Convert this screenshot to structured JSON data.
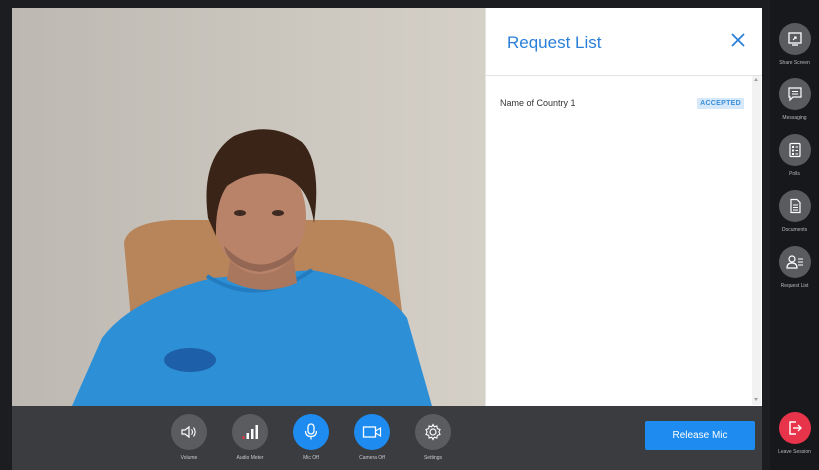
{
  "panel": {
    "title": "Request List",
    "requests": [
      {
        "name": "Name of Country 1",
        "status": "ACCEPTED"
      }
    ]
  },
  "rail": {
    "items": [
      {
        "label": "Share Screen",
        "icon": "share-screen-icon"
      },
      {
        "label": "Messaging",
        "icon": "message-icon"
      },
      {
        "label": "Polls",
        "icon": "polls-icon"
      },
      {
        "label": "Documents",
        "icon": "document-icon"
      },
      {
        "label": "Request List",
        "icon": "request-list-icon"
      }
    ],
    "leave_label": "Leave Session"
  },
  "controls": {
    "items": [
      {
        "label": "Volume",
        "icon": "speaker-icon",
        "active": false
      },
      {
        "label": "Audio Meter",
        "icon": "audio-meter-icon",
        "active": false
      },
      {
        "label": "Mic Off",
        "icon": "microphone-icon",
        "active": true
      },
      {
        "label": "Camera Off",
        "icon": "camera-icon",
        "active": true
      },
      {
        "label": "Settings",
        "icon": "gear-icon",
        "active": false
      }
    ],
    "release_label": "Release Mic"
  },
  "colors": {
    "accent": "#1e8bf0",
    "leave": "#e8344a",
    "title": "#2a80d8",
    "badge_bg": "#d6e9fb"
  }
}
